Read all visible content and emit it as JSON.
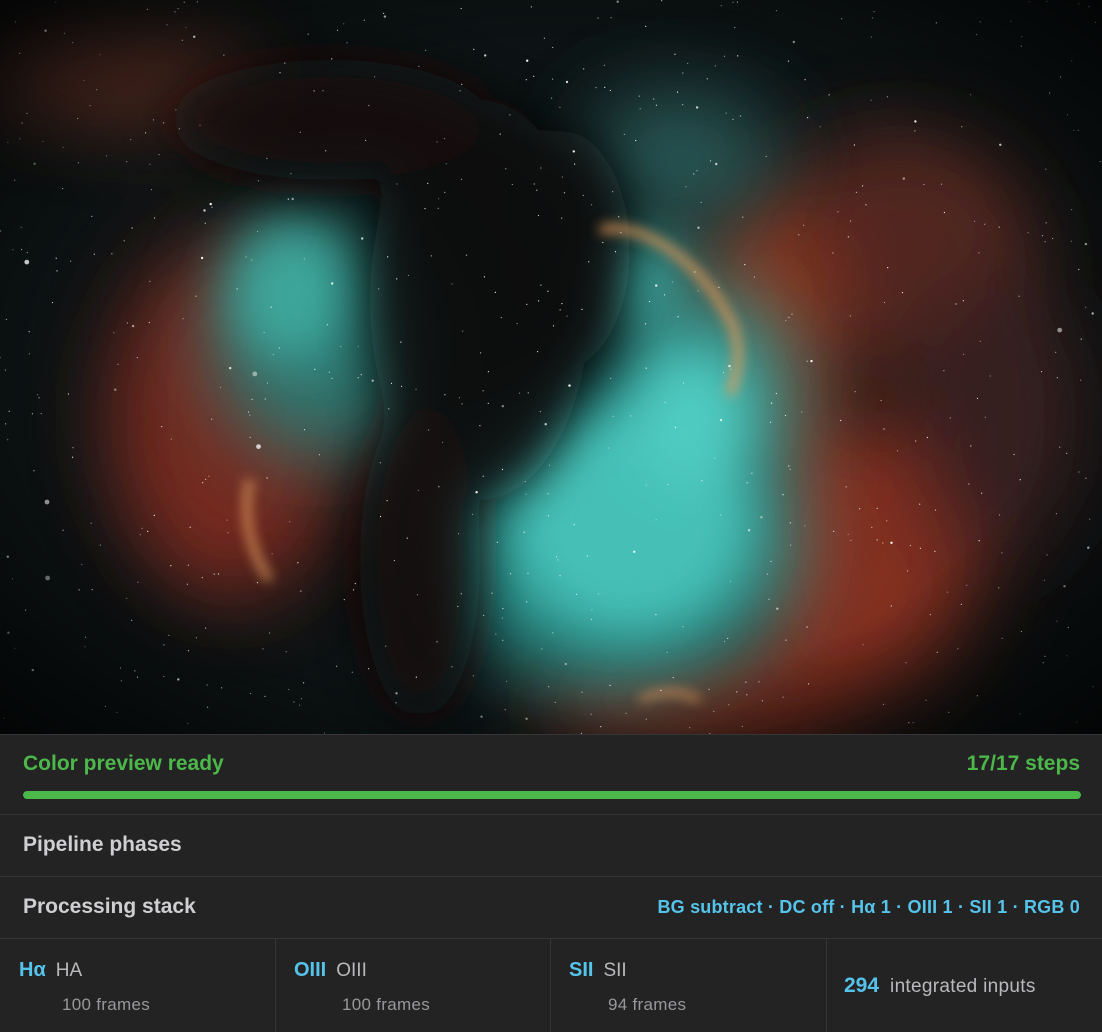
{
  "preview": {
    "alt": "North America and Pelican nebula color preview",
    "palette": {
      "background": "#0c1012",
      "teal": "#57d6c8",
      "orange": "#c8452a",
      "dust": "#120c0b"
    }
  },
  "status": {
    "title": "Color preview ready",
    "steps_label": "17/17 steps",
    "steps_done": 17,
    "steps_total": 17,
    "progress_fraction": 1.0,
    "color": "#4cb84a"
  },
  "phases": {
    "title": "Pipeline phases"
  },
  "processing": {
    "title": "Processing stack",
    "summary": "BG subtract · DC off · Hα 1 · OIII 1 · SII 1 · RGB 0"
  },
  "channels": [
    {
      "symbol": "Hα",
      "name": "HA",
      "frames": "100 frames"
    },
    {
      "symbol": "OIII",
      "name": "OIII",
      "frames": "100 frames"
    },
    {
      "symbol": "SII",
      "name": "SII",
      "frames": "94 frames"
    }
  ],
  "total": {
    "count": "294",
    "label": "integrated inputs"
  },
  "colors": {
    "accent": "#56c4ea",
    "success": "#4cb84a",
    "panel": "#232324"
  }
}
